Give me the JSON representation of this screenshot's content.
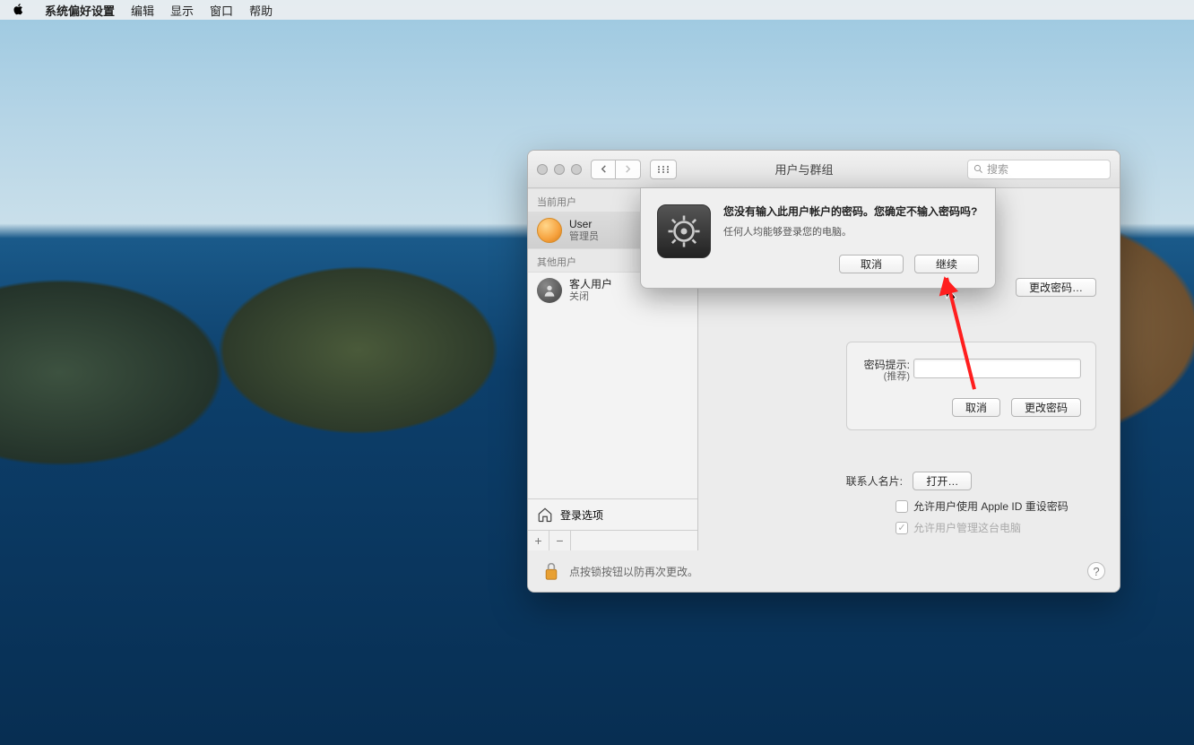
{
  "menubar": {
    "app": "系统偏好设置",
    "items": [
      "编辑",
      "显示",
      "窗口",
      "帮助"
    ]
  },
  "window": {
    "title": "用户与群组",
    "search_placeholder": "搜索",
    "change_password": "更改密码…"
  },
  "sidebar": {
    "hdr_current": "当前用户",
    "user_name": "User",
    "user_role": "管理员",
    "hdr_other": "其他用户",
    "guest_name": "客人用户",
    "guest_role": "关闭",
    "login_options": "登录选项"
  },
  "inner_panel": {
    "hint_label": "密码提示:",
    "hint_sub": "(推荐)",
    "cancel": "取消",
    "change": "更改密码"
  },
  "contact": {
    "label": "联系人名片:",
    "open": "打开…"
  },
  "checkbox": {
    "appleid": "允许用户使用 Apple ID 重设密码",
    "admin": "允许用户管理这台电脑"
  },
  "footer": {
    "lock_text": "点按锁按钮以防再次更改。"
  },
  "sheet": {
    "heading": "您没有输入此用户帐户的密码。您确定不输入密码吗?",
    "message": "任何人均能够登录您的电脑。",
    "cancel": "取消",
    "continue": "继续"
  }
}
